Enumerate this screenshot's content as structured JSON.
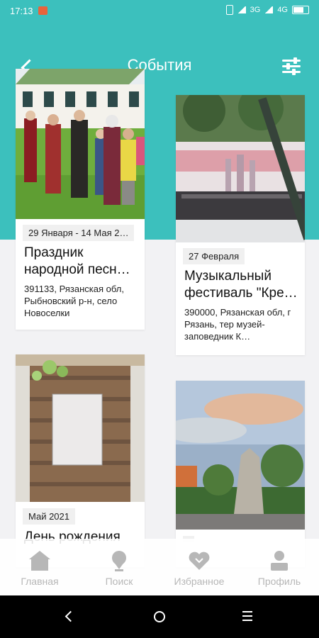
{
  "status_bar": {
    "time": "17:13",
    "network_1": "3G",
    "network_2": "4G"
  },
  "header": {
    "title": "События"
  },
  "events": [
    {
      "date": "29 Января - 14 Мая 2…",
      "title": "Праздник народной песн…",
      "address": "391133, Рязанская обл, Рыбновский р-н, село Новоселки"
    },
    {
      "date": "27 Февраля",
      "title": "Музыкальный фестиваль \"Кре…",
      "address": "390000, Рязанская обл, г Рязань, тер музей-заповедник К…"
    },
    {
      "date": "Май 2021",
      "title": "День рождения"
    },
    {
      "date": ""
    }
  ],
  "bottom_nav": [
    {
      "label": "Главная"
    },
    {
      "label": "Поиск"
    },
    {
      "label": "Избранное"
    },
    {
      "label": "Профиль"
    }
  ],
  "colors": {
    "accent": "#3cc0bd",
    "inactive": "#b7b7b7"
  }
}
